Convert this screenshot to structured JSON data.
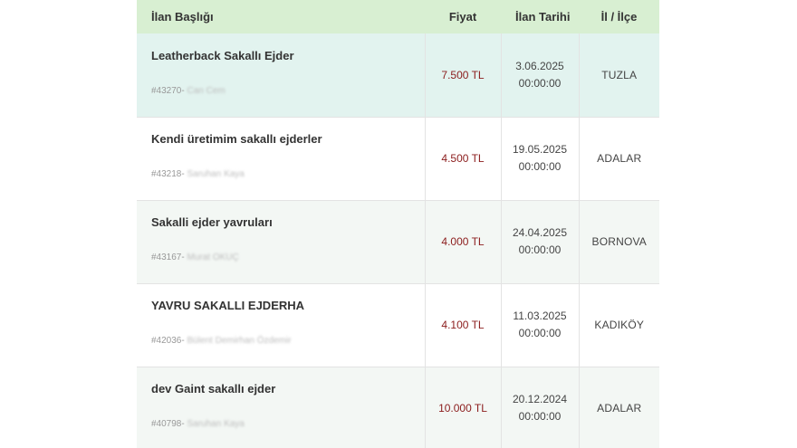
{
  "table": {
    "headers": {
      "title": "İlan Başlığı",
      "price": "Fiyat",
      "date": "İlan Tarihi",
      "location": "İl / İlçe"
    },
    "rows": [
      {
        "title": "Leatherback Sakallı Ejder",
        "id": "#43270-",
        "seller": "Can Cem",
        "price": "7.500 TL",
        "date": "3.06.2025",
        "time": "00:00:00",
        "location": "TUZLA"
      },
      {
        "title": "Kendi üretimim sakallı ejderler",
        "id": "#43218-",
        "seller": "Saruhan Kaya",
        "price": "4.500 TL",
        "date": "19.05.2025",
        "time": "00:00:00",
        "location": "ADALAR"
      },
      {
        "title": "Sakalli ejder yavruları",
        "id": "#43167-",
        "seller": "Murat OKUÇ",
        "price": "4.000 TL",
        "date": "24.04.2025",
        "time": "00:00:00",
        "location": "BORNOVA"
      },
      {
        "title": "YAVRU SAKALLI EJDERHA",
        "id": "#42036-",
        "seller": "Bülent Demirhan Özdemir",
        "price": "4.100 TL",
        "date": "11.03.2025",
        "time": "00:00:00",
        "location": "KADIKÖY"
      },
      {
        "title": "dev Gaint sakallı ejder",
        "id": "#40798-",
        "seller": "Saruhan Kaya",
        "price": "10.000 TL",
        "date": "20.12.2024",
        "time": "00:00:00",
        "location": "ADALAR"
      }
    ]
  },
  "colors": {
    "header_bg": "#d8efd2",
    "active_row_bg": "#e2f3ef",
    "price_color": "#8b1c1c"
  }
}
